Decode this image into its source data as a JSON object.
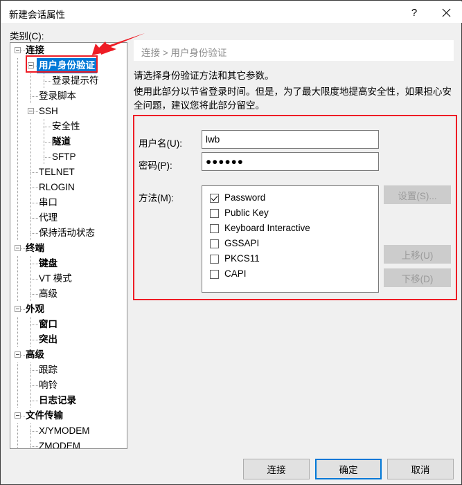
{
  "window": {
    "title": "新建会话属性",
    "help_label": "?",
    "close_label": "✕"
  },
  "category": {
    "label": "类别(C):",
    "tree": [
      {
        "label": "连接",
        "depth": 0,
        "bold": true,
        "expander": true,
        "selected": false
      },
      {
        "label": "用户身份验证",
        "depth": 1,
        "bold": true,
        "expander": true,
        "selected": true
      },
      {
        "label": "登录提示符",
        "depth": 2,
        "bold": false,
        "expander": false,
        "selected": false
      },
      {
        "label": "登录脚本",
        "depth": 1,
        "bold": false,
        "expander": false,
        "selected": false
      },
      {
        "label": "SSH",
        "depth": 1,
        "bold": false,
        "expander": true,
        "selected": false
      },
      {
        "label": "安全性",
        "depth": 2,
        "bold": false,
        "expander": false,
        "selected": false
      },
      {
        "label": "隧道",
        "depth": 2,
        "bold": true,
        "expander": false,
        "selected": false
      },
      {
        "label": "SFTP",
        "depth": 2,
        "bold": false,
        "expander": false,
        "selected": false
      },
      {
        "label": "TELNET",
        "depth": 1,
        "bold": false,
        "expander": false,
        "selected": false
      },
      {
        "label": "RLOGIN",
        "depth": 1,
        "bold": false,
        "expander": false,
        "selected": false
      },
      {
        "label": "串口",
        "depth": 1,
        "bold": false,
        "expander": false,
        "selected": false
      },
      {
        "label": "代理",
        "depth": 1,
        "bold": false,
        "expander": false,
        "selected": false
      },
      {
        "label": "保持活动状态",
        "depth": 1,
        "bold": false,
        "expander": false,
        "selected": false
      },
      {
        "label": "终端",
        "depth": 0,
        "bold": true,
        "expander": true,
        "selected": false
      },
      {
        "label": "键盘",
        "depth": 1,
        "bold": true,
        "expander": false,
        "selected": false
      },
      {
        "label": "VT 模式",
        "depth": 1,
        "bold": false,
        "expander": false,
        "selected": false
      },
      {
        "label": "高级",
        "depth": 1,
        "bold": false,
        "expander": false,
        "selected": false
      },
      {
        "label": "外观",
        "depth": 0,
        "bold": true,
        "expander": true,
        "selected": false
      },
      {
        "label": "窗口",
        "depth": 1,
        "bold": true,
        "expander": false,
        "selected": false
      },
      {
        "label": "突出",
        "depth": 1,
        "bold": true,
        "expander": false,
        "selected": false
      },
      {
        "label": "高级",
        "depth": 0,
        "bold": true,
        "expander": true,
        "selected": false
      },
      {
        "label": "跟踪",
        "depth": 1,
        "bold": false,
        "expander": false,
        "selected": false
      },
      {
        "label": "响铃",
        "depth": 1,
        "bold": false,
        "expander": false,
        "selected": false
      },
      {
        "label": "日志记录",
        "depth": 1,
        "bold": true,
        "expander": false,
        "selected": false
      },
      {
        "label": "文件传输",
        "depth": 0,
        "bold": true,
        "expander": true,
        "selected": false
      },
      {
        "label": "X/YMODEM",
        "depth": 1,
        "bold": false,
        "expander": false,
        "selected": false
      },
      {
        "label": "ZMODEM",
        "depth": 1,
        "bold": false,
        "expander": false,
        "selected": false
      }
    ]
  },
  "content": {
    "breadcrumb": "连接 > 用户身份验证",
    "description_1": "请选择身份验证方法和其它参数。",
    "description_2": "使用此部分以节省登录时间。但是，为了最大限度地提高安全性，如果担心安全问题，建议您将此部分留空。",
    "username": {
      "label": "用户名(U):",
      "value": "lwb"
    },
    "password": {
      "label": "密码(P):",
      "value": "●●●●●●"
    },
    "method": {
      "label": "方法(M):",
      "items": [
        {
          "label": "Password",
          "checked": true
        },
        {
          "label": "Public Key",
          "checked": false
        },
        {
          "label": "Keyboard Interactive",
          "checked": false
        },
        {
          "label": "GSSAPI",
          "checked": false
        },
        {
          "label": "PKCS11",
          "checked": false
        },
        {
          "label": "CAPI",
          "checked": false
        }
      ]
    },
    "side_buttons": {
      "settings": "设置(S)...",
      "move_up": "上移(U)",
      "move_down": "下移(D)"
    }
  },
  "footer": {
    "connect": "连接",
    "ok": "确定",
    "cancel": "取消"
  },
  "annotations": {
    "highlight_color": "#ee1c25",
    "arrow": "red-arrow-pointing-to-selected-tree-item",
    "box_tree": "red-box-around-user-authentication",
    "box_form": "red-box-around-authentication-form"
  },
  "colors": {
    "accent": "#0078d7",
    "dialog_bg": "#f0f0f0",
    "highlight": "#ee1c25"
  }
}
